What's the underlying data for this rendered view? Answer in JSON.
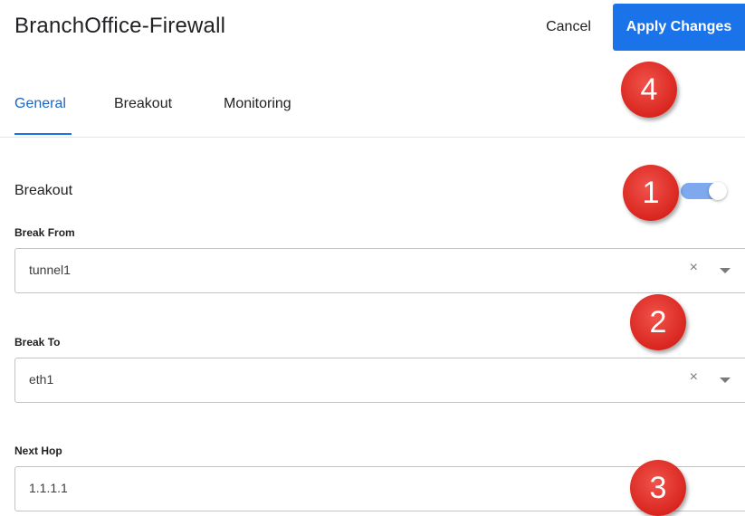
{
  "header": {
    "title": "BranchOffice-Firewall",
    "cancel_label": "Cancel",
    "apply_label": "Apply Changes"
  },
  "tabs": [
    {
      "label": "General",
      "active": true
    },
    {
      "label": "Breakout",
      "active": false
    },
    {
      "label": "Monitoring",
      "active": false
    }
  ],
  "breakout": {
    "label": "Breakout",
    "enabled": true
  },
  "fields": {
    "break_from": {
      "label": "Break From",
      "value": "tunnel1",
      "clear_glyph": "×"
    },
    "break_to": {
      "label": "Break To",
      "value": "eth1",
      "clear_glyph": "×"
    },
    "next_hop": {
      "label": "Next Hop",
      "value": "1.1.1.1"
    }
  },
  "markers": [
    "1",
    "2",
    "3",
    "4"
  ],
  "colors": {
    "accent": "#1a73e8",
    "toggle_on": "#7fa9ee",
    "marker_red": "#d9261f"
  }
}
